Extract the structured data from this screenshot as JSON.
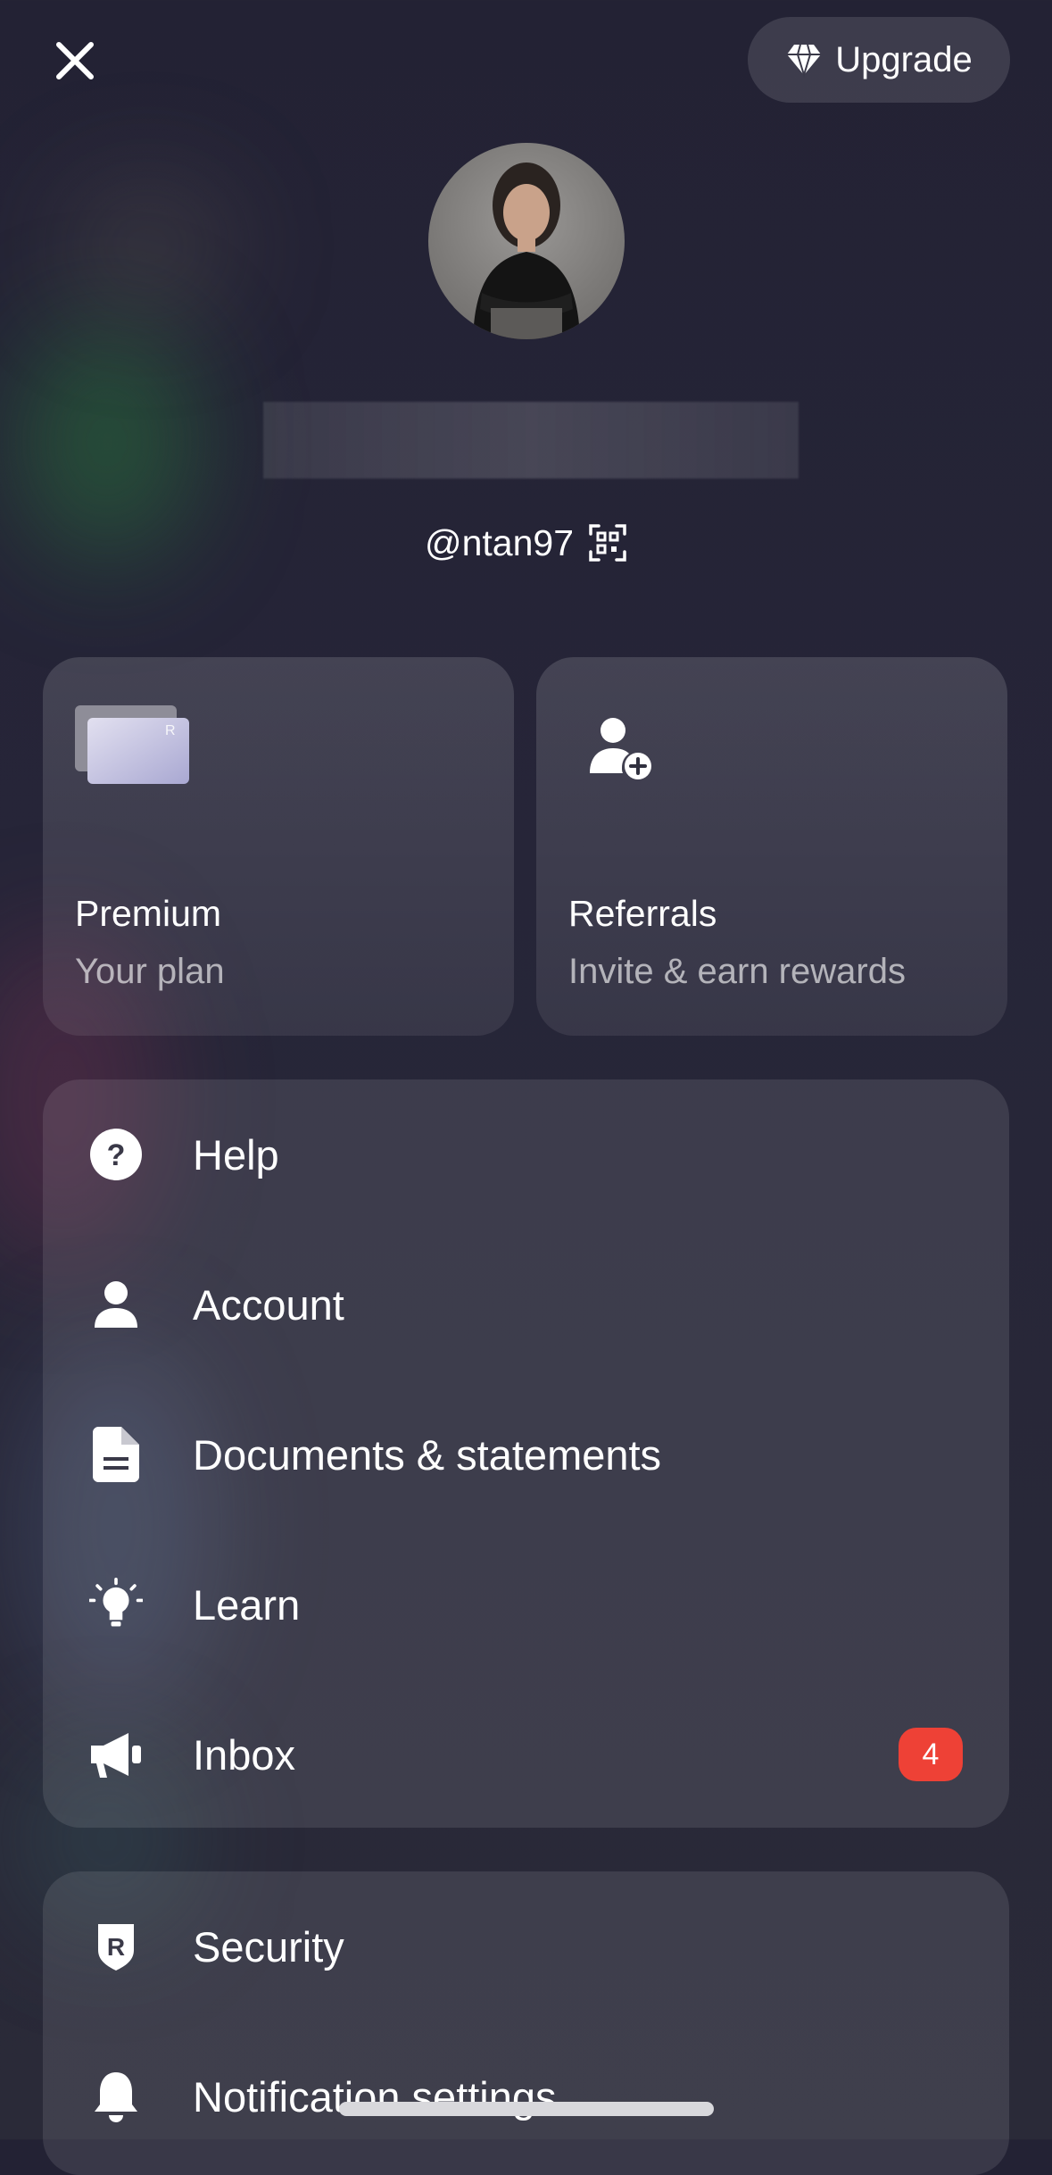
{
  "header": {
    "upgrade_label": "Upgrade"
  },
  "profile": {
    "handle": "@ntan97"
  },
  "cards": {
    "plan": {
      "title": "Premium",
      "subtitle": "Your plan",
      "card_letter": "R"
    },
    "referrals": {
      "title": "Referrals",
      "subtitle": "Invite & earn rewards"
    }
  },
  "menu": {
    "items": [
      {
        "label": "Help",
        "icon": "help-icon"
      },
      {
        "label": "Account",
        "icon": "person-icon"
      },
      {
        "label": "Documents & statements",
        "icon": "document-icon"
      },
      {
        "label": "Learn",
        "icon": "lightbulb-icon"
      },
      {
        "label": "Inbox",
        "icon": "megaphone-icon",
        "badge": "4"
      }
    ]
  },
  "menu2": {
    "items": [
      {
        "label": "Security",
        "icon": "shield-icon"
      },
      {
        "label": "Notification settings",
        "icon": "bell-icon"
      }
    ]
  },
  "colors": {
    "badge": "#ee4136",
    "background": "#232234"
  }
}
